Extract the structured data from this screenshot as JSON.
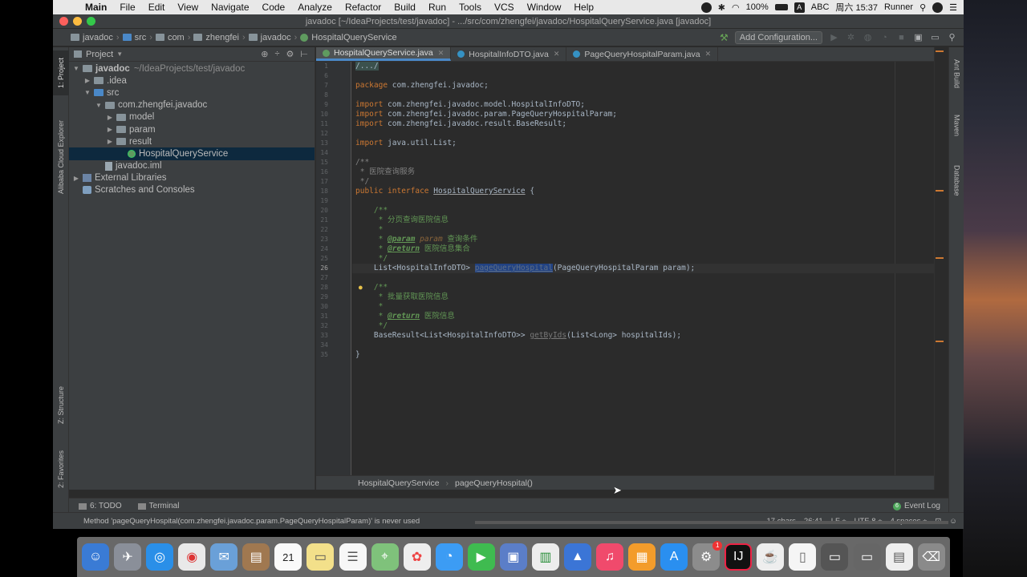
{
  "menubar": {
    "app_name": "Main",
    "items": [
      "File",
      "Edit",
      "View",
      "Navigate",
      "Code",
      "Analyze",
      "Refactor",
      "Build",
      "Run",
      "Tools",
      "VCS",
      "Window",
      "Help"
    ],
    "battery": "100%",
    "input_method": "ABC",
    "clock": "周六 15:37",
    "user": "Runner"
  },
  "window": {
    "title": "javadoc [~/IdeaProjects/test/javadoc] - .../src/com/zhengfei/javadoc/HospitalQueryService.java [javadoc]"
  },
  "navbar": {
    "crumbs": [
      "javadoc",
      "src",
      "com",
      "zhengfei",
      "javadoc",
      "HospitalQueryService"
    ],
    "add_configuration": "Add Configuration..."
  },
  "left_strip": {
    "project_tab": "1: Project",
    "cloud_tab": "Alibaba Cloud Explorer",
    "structure_tab": "Z: Structure",
    "favorites_tab": "2: Favorites"
  },
  "project_panel": {
    "title": "Project",
    "tree": [
      {
        "label": "javadoc",
        "path": "~/IdeaProjects/test/javadoc"
      },
      {
        "label": ".idea"
      },
      {
        "label": "src"
      },
      {
        "label": "com.zhengfei.javadoc"
      },
      {
        "label": "model"
      },
      {
        "label": "param"
      },
      {
        "label": "result"
      },
      {
        "label": "HospitalQueryService"
      },
      {
        "label": "javadoc.iml"
      },
      {
        "label": "External Libraries"
      },
      {
        "label": "Scratches and Consoles"
      }
    ]
  },
  "editor": {
    "tabs": [
      {
        "label": "HospitalQueryService.java"
      },
      {
        "label": "HospitalInfoDTO.java"
      },
      {
        "label": "PageQueryHospitalParam.java"
      }
    ],
    "line_numbers": [
      "1",
      "6",
      "7",
      "8",
      "9",
      "10",
      "11",
      "12",
      "13",
      "14",
      "15",
      "16",
      "17",
      "18",
      "19",
      "20",
      "21",
      "22",
      "23",
      "24",
      "25",
      "26",
      "27",
      "28",
      "29",
      "30",
      "31",
      "32",
      "33",
      "34",
      "35"
    ],
    "code": {
      "l1": "/.../",
      "l7_kw": "package",
      "l7_rest": " com.zhengfei.javadoc;",
      "l9_kw": "import",
      "l9_rest": " com.zhengfei.javadoc.model.HospitalInfoDTO;",
      "l10_kw": "import",
      "l10_rest": " com.zhengfei.javadoc.param.PageQueryHospitalParam;",
      "l11_kw": "import",
      "l11_rest": " com.zhengfei.javadoc.result.BaseResult;",
      "l13_kw": "import",
      "l13_rest": " java.util.List;",
      "l15": "/**",
      "l16": " * 医院查询服务",
      "l17": " */",
      "l18_kw": "public interface ",
      "l18_name": "HospitalQueryService",
      "l18_rest": " {",
      "l20": "    /**",
      "l21": "     * 分页查询医院信息",
      "l22": "     *",
      "l23_pre": "     * ",
      "l23_tag": "@param",
      "l23_param": " param",
      "l23_desc": " 查询条件",
      "l24_pre": "     * ",
      "l24_tag": "@return",
      "l24_desc": " 医院信息集合",
      "l25": "     */",
      "l26_pre": "    List<HospitalInfoDTO> ",
      "l26_method": "pageQueryHospital",
      "l26_rest": "(PageQueryHospitalParam param);",
      "l28": "    /**",
      "l29": "     * 批量获取医院信息",
      "l30": "     *",
      "l31_pre": "     * ",
      "l31_tag": "@return",
      "l31_desc": " 医院信息",
      "l32": "     */",
      "l33_pre": "    BaseResult<List<HospitalInfoDTO>> ",
      "l33_method": "getByIds",
      "l33_rest": "(List<Long> hospitalIds);",
      "l35": "}"
    },
    "breadcrumb": [
      "HospitalQueryService",
      "pageQueryHospital()"
    ]
  },
  "right_strip": {
    "ant_tab": "Ant Build",
    "maven_tab": "Maven",
    "database_tab": "Database"
  },
  "bottom_tools": {
    "todo": "6: TODO",
    "terminal": "Terminal",
    "event_log": "Event Log",
    "event_log_badge": "6"
  },
  "statusbar": {
    "message": "Method 'pageQueryHospital(com.zhengfei.javadoc.param.PageQueryHospitalParam)' is never used",
    "chars": "17 chars",
    "position": "26:41",
    "line_sep": "LF ÷",
    "encoding": "UTF-8 ÷",
    "indent": "4 spaces ÷"
  },
  "dock": {
    "date_icon": "21",
    "badge": "1"
  }
}
